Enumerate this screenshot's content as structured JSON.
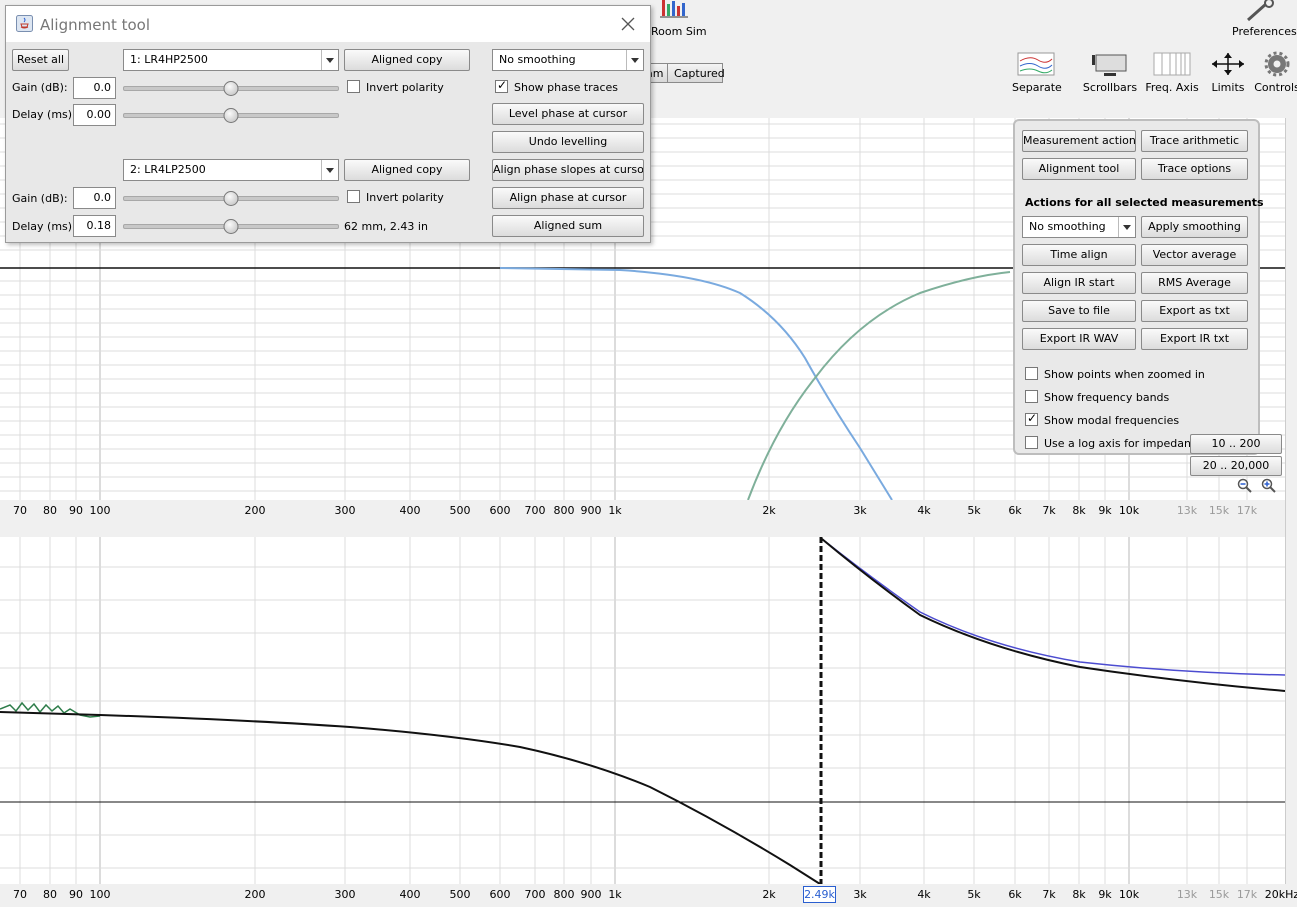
{
  "toolbar": {
    "room_sim": "Room Sim",
    "preferences": "Preferences",
    "tab_partial": "am",
    "tab_captured": "Captured",
    "buttons": [
      {
        "label": "Separate",
        "icon": "separate-icon"
      },
      {
        "label": "Scrollbars",
        "icon": "scrollbars-icon"
      },
      {
        "label": "Freq. Axis",
        "icon": "freq-axis-icon"
      },
      {
        "label": "Limits",
        "icon": "limits-icon"
      },
      {
        "label": "Controls",
        "icon": "gear-icon"
      }
    ]
  },
  "dialog": {
    "title": "Alignment tool",
    "reset_all": "Reset all",
    "m1": {
      "name": "1: LR4HP2500",
      "aligned_copy": "Aligned copy",
      "gain_label": "Gain (dB):",
      "gain": "0.0",
      "delay_label": "Delay (ms):",
      "delay": "0.00",
      "invert": "Invert polarity",
      "invert_checked": false
    },
    "m2": {
      "name": "2: LR4LP2500",
      "aligned_copy": "Aligned copy",
      "gain_label": "Gain (dB):",
      "gain": "0.0",
      "delay_label": "Delay (ms):",
      "delay": "0.18",
      "invert": "Invert polarity",
      "invert_checked": false,
      "distance": "62 mm, 2.43 in"
    },
    "smoothing": "No  smoothing",
    "show_phase_traces": "Show phase traces",
    "show_phase_checked": true,
    "level_phase": "Level phase at cursor",
    "undo_levelling": "Undo levelling",
    "align_slopes": "Align phase slopes at cursor",
    "align_phase": "Align phase at cursor",
    "aligned_sum": "Aligned sum"
  },
  "actions": {
    "measurement_actions": "Measurement actions",
    "trace_arithmetic": "Trace arithmetic",
    "alignment_tool": "Alignment tool",
    "trace_options": "Trace options",
    "heading": "Actions for all selected measurements",
    "smoothing": "No  smoothing",
    "apply_smoothing": "Apply smoothing",
    "time_align": "Time align",
    "vector_average": "Vector average",
    "align_ir_start": "Align IR start",
    "rms_average": "RMS Average",
    "save_to_file": "Save to file",
    "export_txt": "Export as txt",
    "export_ir_wav": "Export IR WAV",
    "export_ir_txt": "Export IR txt",
    "show_points": "Show points when zoomed in",
    "show_points_checked": false,
    "show_bands": "Show frequency bands",
    "show_bands_checked": false,
    "show_modal": "Show modal frequencies",
    "show_modal_checked": true,
    "log_axis": "Use a log axis for impedance",
    "log_axis_checked": false,
    "range_1": "10 .. 200",
    "range_2": "20 .. 20,000"
  },
  "axis": {
    "ticks": [
      "70",
      "80",
      "90",
      "100",
      "200",
      "300",
      "400",
      "500",
      "600",
      "700",
      "800",
      "900",
      "1k",
      "2k",
      "3k",
      "4k",
      "5k",
      "6k",
      "7k",
      "8k",
      "9k",
      "10k",
      "13k",
      "15k",
      "17k"
    ],
    "bottom_last": "20kHz",
    "cursor_label": "2.49k"
  },
  "colors": {
    "hp_trace": "#7aaadf",
    "lp_trace": "#7fb09a",
    "sum_trace": "#111111",
    "phase_blue": "#4c4cd0",
    "phase_green": "#2e7d4a"
  }
}
